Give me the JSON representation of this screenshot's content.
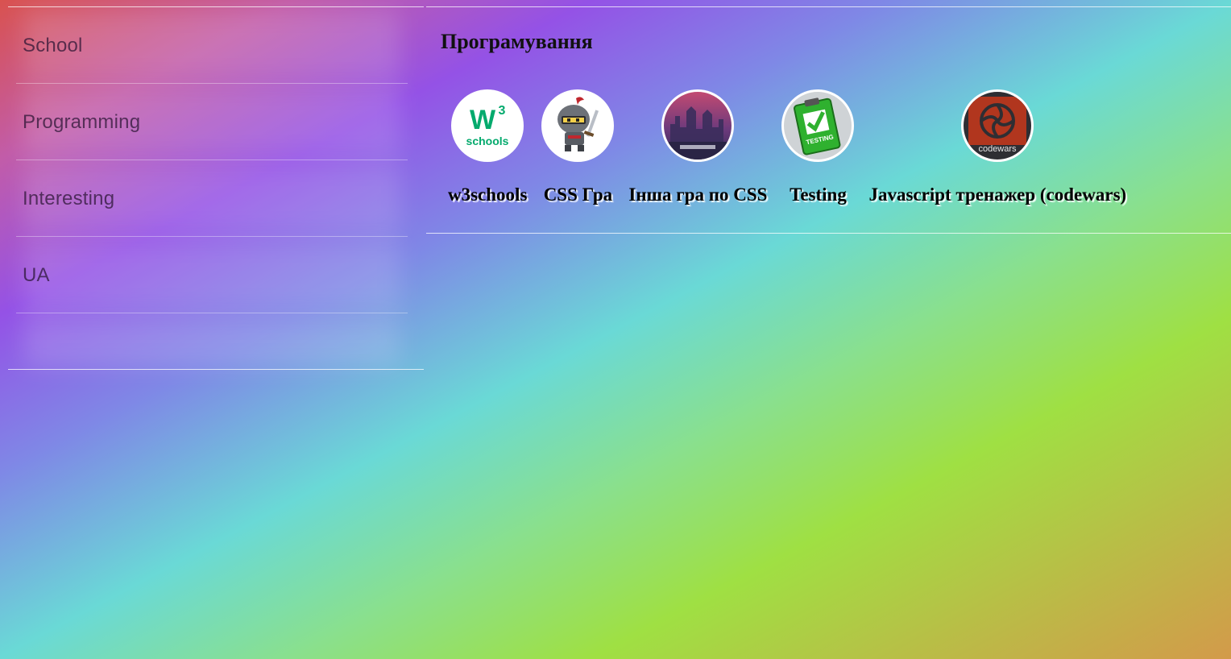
{
  "sidebar": {
    "items": [
      {
        "label": "School"
      },
      {
        "label": "Programming"
      },
      {
        "label": "Interesting"
      },
      {
        "label": "UA"
      }
    ]
  },
  "main": {
    "title": "Програмування",
    "links": [
      {
        "label": "w3schools",
        "icon": "w3schools-logo-icon"
      },
      {
        "label": "CSS Гра",
        "icon": "knight-icon"
      },
      {
        "label": "Інша гра по CSS",
        "icon": "castle-game-icon"
      },
      {
        "label": "Testing",
        "icon": "testing-clipboard-icon"
      },
      {
        "label": "Javascript тренажер (codewars)",
        "icon": "codewars-logo-icon"
      }
    ],
    "logo_texts": {
      "w3_big": "W",
      "w3_sup": "3",
      "w3_small": "schools",
      "testing": "TESTING",
      "codewars": "codewars"
    }
  },
  "colors": {
    "w3_green": "#04aa6d",
    "codewars_red": "#b1361e",
    "testing_green": "#2fb12f"
  }
}
